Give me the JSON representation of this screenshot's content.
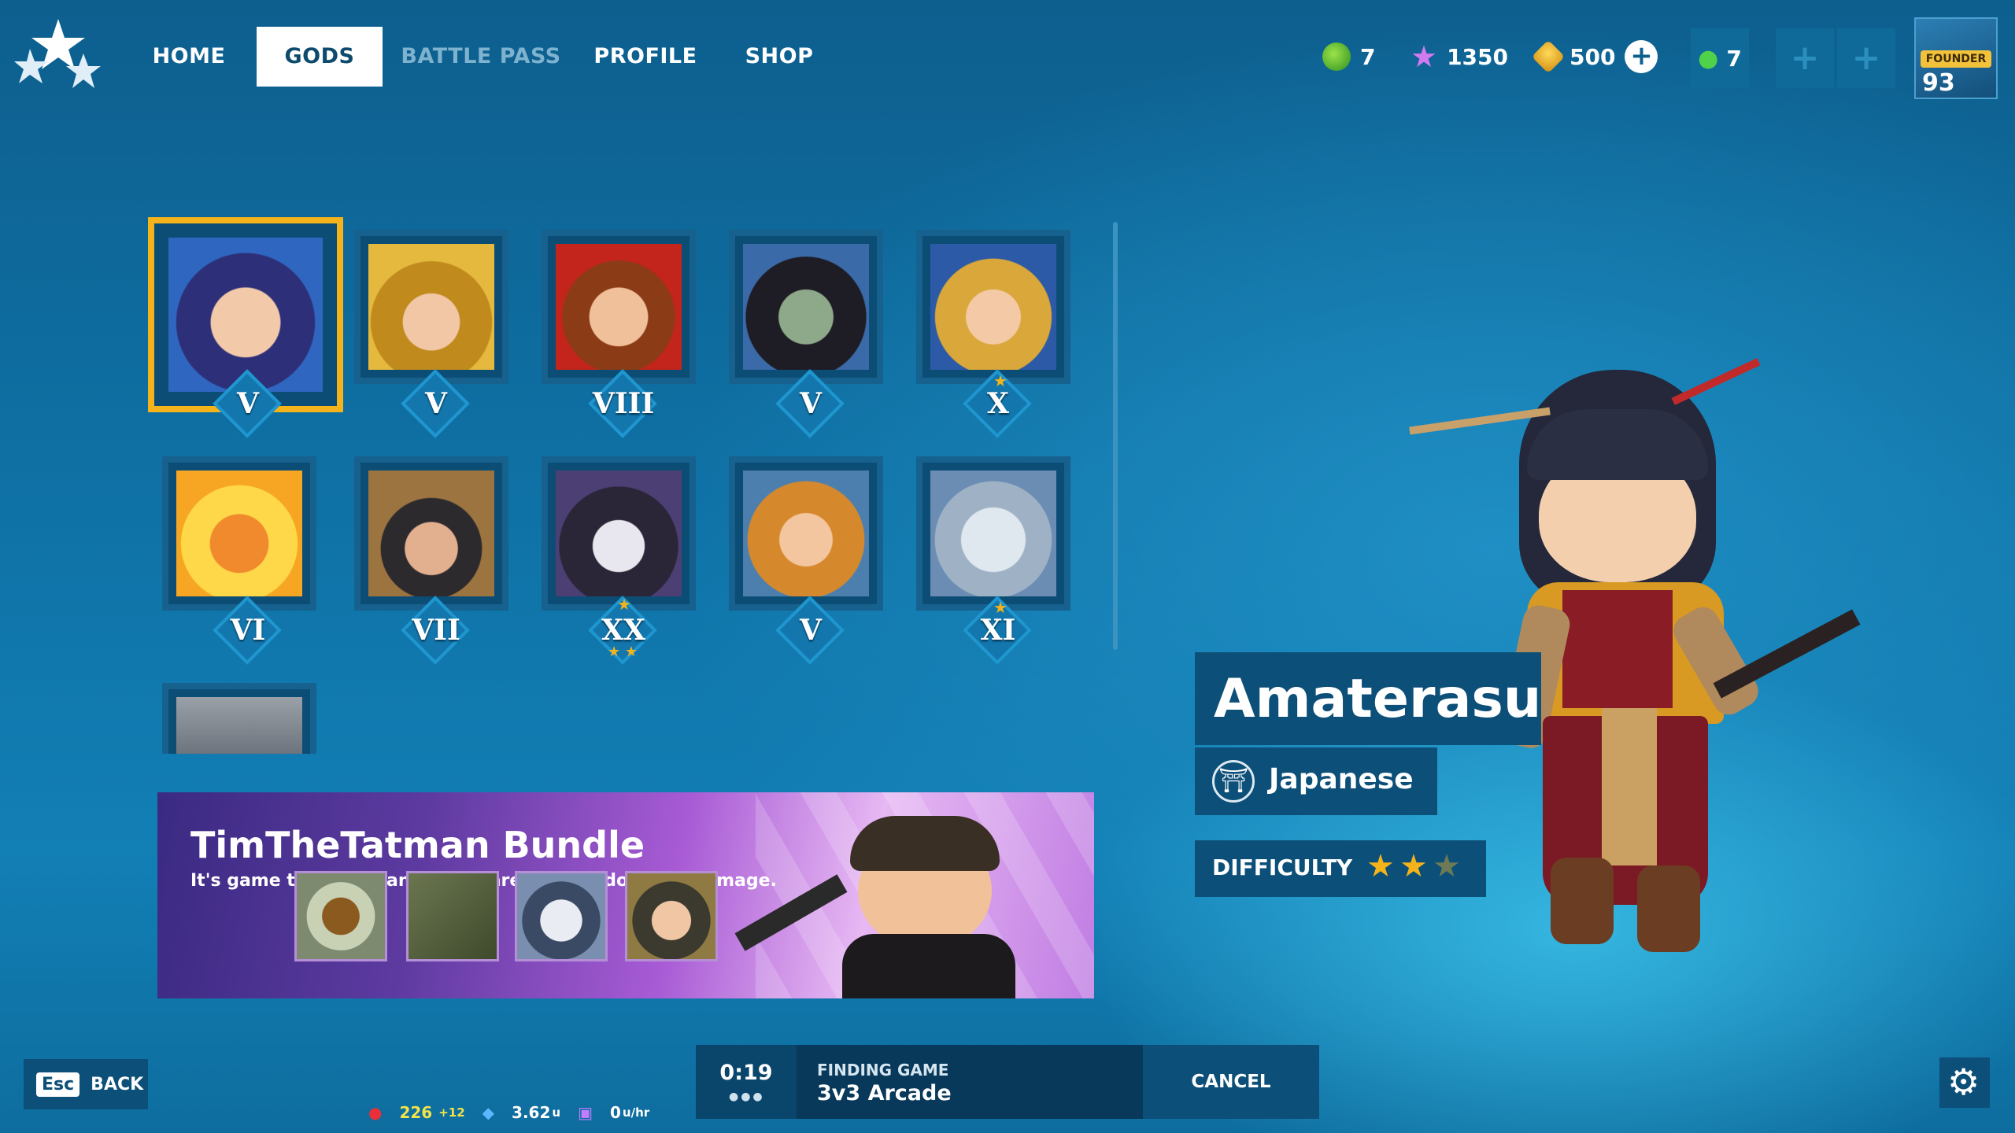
{
  "nav": {
    "items": [
      {
        "label": "HOME"
      },
      {
        "label": "GODS"
      },
      {
        "label": "BATTLE PASS"
      },
      {
        "label": "PROFILE"
      },
      {
        "label": "SHOP"
      }
    ],
    "active": "GODS"
  },
  "currencies": {
    "green": "7",
    "stars": "1350",
    "gold": "500",
    "party_count": "7"
  },
  "profile": {
    "badge_label": "FOUNDER",
    "level": "93"
  },
  "gods": [
    {
      "rank": "V"
    },
    {
      "rank": "V"
    },
    {
      "rank": "VIII"
    },
    {
      "rank": "V"
    },
    {
      "rank": "X"
    },
    {
      "rank": "VI"
    },
    {
      "rank": "VII"
    },
    {
      "rank": "XX"
    },
    {
      "rank": "V"
    },
    {
      "rank": "XI"
    }
  ],
  "bundle": {
    "title": "TimTheTatman Bundle",
    "subtitle": "It's game time! Tim and Kevin are here to do some damage."
  },
  "selected_god": {
    "name": "Amaterasu",
    "pantheon": "Japanese",
    "difficulty_label": "DIFFICULTY",
    "difficulty": 2,
    "difficulty_max": 3
  },
  "queue": {
    "timer": "0:19",
    "status": "FINDING GAME",
    "mode": "3v3 Arcade",
    "cancel_label": "CANCEL"
  },
  "back": {
    "key": "Esc",
    "label": "BACK"
  },
  "stats": {
    "ping": "226",
    "ping_delta": "+12",
    "upload": "3.62",
    "upload_unit": "u",
    "download": "0",
    "download_unit": "u/hr"
  },
  "colors": {
    "accent_gold": "#f4b31a",
    "panel": "#0c4f78",
    "background": "#0f72a6"
  }
}
